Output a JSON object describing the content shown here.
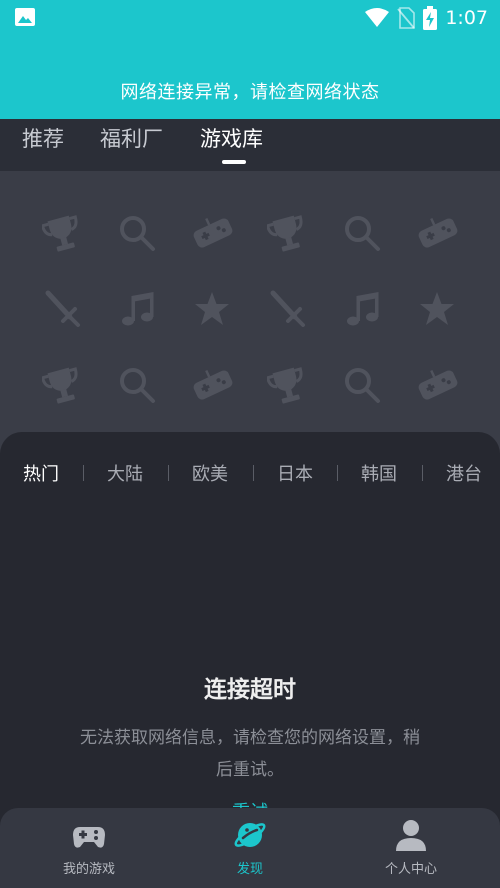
{
  "status_bar": {
    "time": "1:07",
    "icons": [
      "image-icon",
      "wifi-icon",
      "no-sim-icon",
      "battery-charging-icon"
    ]
  },
  "banner": {
    "text": "网络连接异常，请检查网络状态"
  },
  "tabs": [
    {
      "label": "推荐",
      "active": false
    },
    {
      "label": "福利厂",
      "active": false
    },
    {
      "label": "游戏库",
      "active": true
    }
  ],
  "pattern_icons": [
    "trophy-icon",
    "magnifier-icon",
    "gamepad-icon",
    "sword-icon",
    "music-note-icon",
    "star-icon"
  ],
  "regions": [
    {
      "label": "热门",
      "active": true
    },
    {
      "label": "大陆",
      "active": false
    },
    {
      "label": "欧美",
      "active": false
    },
    {
      "label": "日本",
      "active": false
    },
    {
      "label": "韩国",
      "active": false
    },
    {
      "label": "港台",
      "active": false
    }
  ],
  "error": {
    "title": "连接超时",
    "message": "无法获取网络信息，请检查您的网络设置，稍后重试。",
    "retry_label": "重试"
  },
  "bottom_nav": [
    {
      "label": "我的游戏",
      "icon": "gamepad-icon",
      "active": false
    },
    {
      "label": "发现",
      "icon": "planet-icon",
      "active": true
    },
    {
      "label": "个人中心",
      "icon": "person-icon",
      "active": false
    }
  ],
  "colors": {
    "accent": "#1cc6cc",
    "background": "#3a3d47",
    "card": "#262830",
    "nav": "#353842"
  }
}
